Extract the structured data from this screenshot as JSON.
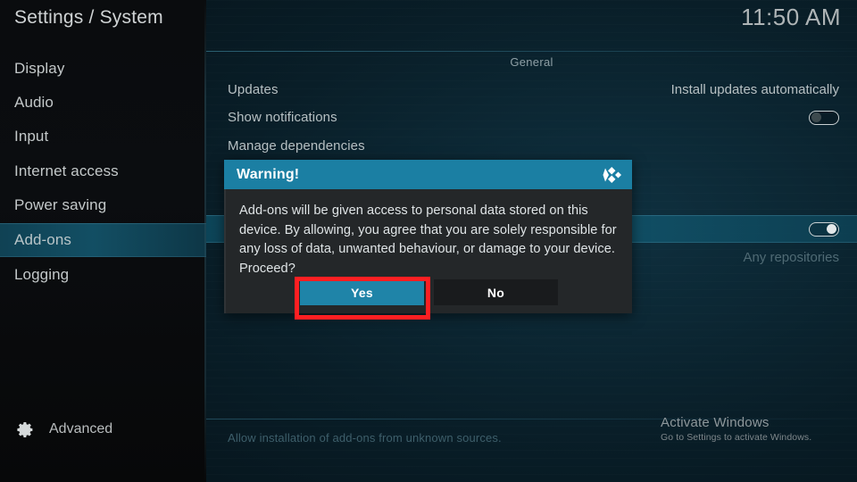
{
  "window": {
    "title": "Settings / System",
    "clock": "11:50 AM"
  },
  "sidebar": {
    "items": [
      {
        "label": "Display",
        "selected": false
      },
      {
        "label": "Audio",
        "selected": false
      },
      {
        "label": "Input",
        "selected": false
      },
      {
        "label": "Internet access",
        "selected": false
      },
      {
        "label": "Power saving",
        "selected": false
      },
      {
        "label": "Add-ons",
        "selected": true
      },
      {
        "label": "Logging",
        "selected": false
      }
    ],
    "advanced": {
      "label": "Advanced",
      "icon": "gear-icon"
    }
  },
  "content": {
    "section_header": "General",
    "rows": [
      {
        "label": "Updates",
        "value": "Install updates automatically",
        "control": "none"
      },
      {
        "label": "Show notifications",
        "value": "",
        "control": "toggle",
        "toggle_state": "off"
      },
      {
        "label": "Manage dependencies",
        "value": "",
        "control": "none"
      },
      {
        "label": "",
        "value": "",
        "control": "toggle",
        "toggle_state": "on",
        "highlighted": true
      },
      {
        "label": "",
        "value": "Any repositories",
        "control": "none",
        "dim": true
      }
    ],
    "hint": "Allow installation of add-ons from unknown sources."
  },
  "dialog": {
    "title": "Warning!",
    "logo": "kodi-logo-icon",
    "message": "Add-ons will be given access to personal data stored on this device. By allowing, you agree that you are solely responsible for any loss of data, unwanted behaviour, or damage to your device. Proceed?",
    "buttons": {
      "yes": "Yes",
      "no": "No"
    },
    "focused_button": "Yes"
  },
  "watermark": {
    "title": "Activate Windows",
    "subtitle": "Go to Settings to activate Windows."
  },
  "colors": {
    "accent_teal": "#1b7fa3",
    "yes_button": "#1f84a8",
    "highlight_row": "#125870",
    "annotation_red": "#ff1f22",
    "dialog_body": "#242729"
  }
}
